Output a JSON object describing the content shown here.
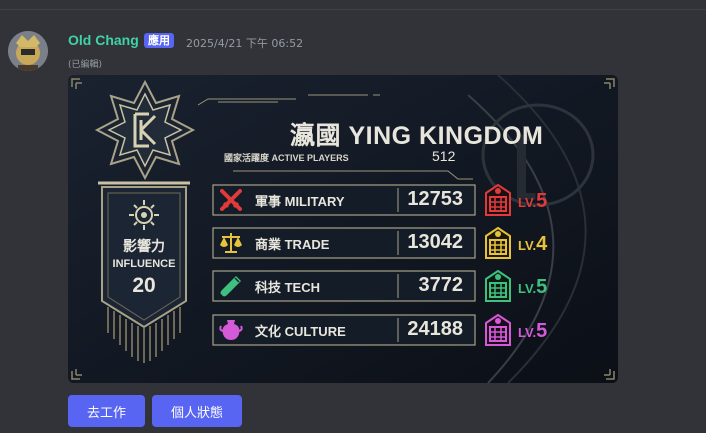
{
  "message": {
    "username": "Old Chang",
    "app_badge": "應用",
    "timestamp": "2025/4/21 下午 06:52",
    "edited_label": "(已編輯)"
  },
  "card": {
    "title": "瀛國 YING KINGDOM",
    "active_players_label": "國家活躍度 ACTIVE PLAYERS",
    "active_players_value": "512",
    "influence": {
      "label_zh": "影響力",
      "label_en": "INFLUENCE",
      "value": "20"
    },
    "stats": [
      {
        "label": "軍事 MILITARY",
        "value": "12753",
        "level_prefix": "LV.",
        "level": "5",
        "color": "#e03a3a",
        "icon": "crossed-swords-icon"
      },
      {
        "label": "商業 TRADE",
        "value": "13042",
        "level_prefix": "LV.",
        "level": "4",
        "color": "#e8c23a",
        "icon": "scales-icon"
      },
      {
        "label": "科技 TECH",
        "value": "3772",
        "level_prefix": "LV.",
        "level": "5",
        "color": "#3fc07e",
        "icon": "test-tube-icon"
      },
      {
        "label": "文化 CULTURE",
        "value": "24188",
        "level_prefix": "LV.",
        "level": "5",
        "color": "#d45ad8",
        "icon": "vase-icon"
      }
    ]
  },
  "buttons": {
    "work": "去工作",
    "status": "個人狀態"
  }
}
